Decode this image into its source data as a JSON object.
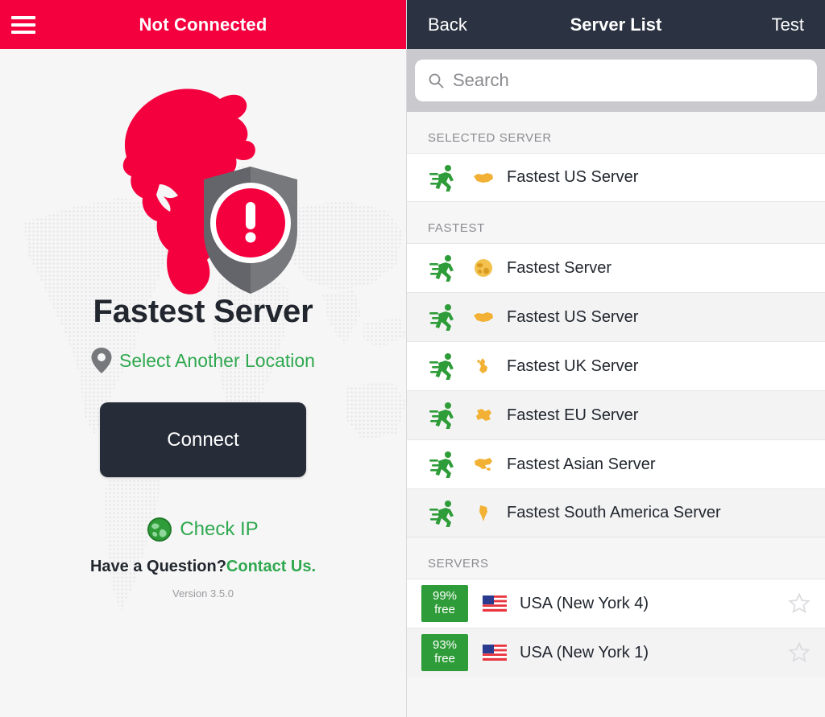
{
  "left": {
    "header": {
      "menu_icon": "hamburger-icon",
      "status_title": "Not Connected"
    },
    "logo": {
      "icon": "detective-shield-alert-logo"
    },
    "brand_title": "Fastest Server",
    "select_location": {
      "icon": "map-pin-icon",
      "label": "Select Another Location"
    },
    "connect_button": "Connect",
    "check_ip": {
      "icon": "globe-icon",
      "label": "Check IP"
    },
    "footer": {
      "question_text": "Have a Question?",
      "contact_link": "Contact Us.",
      "version": "Version 3.5.0"
    }
  },
  "right": {
    "header": {
      "back": "Back",
      "title": "Server List",
      "test": "Test"
    },
    "search": {
      "icon": "search-icon",
      "value": "",
      "placeholder": "Search"
    },
    "sections": [
      {
        "id": "selected-server",
        "title": "SELECTED SERVER",
        "rows": [
          {
            "icon": "runner-icon",
            "region_icon": "usa-map-icon",
            "label": "Fastest US Server"
          }
        ]
      },
      {
        "id": "fastest",
        "title": "FASTEST",
        "rows": [
          {
            "icon": "runner-icon",
            "region_icon": "globe-icon",
            "label": "Fastest Server"
          },
          {
            "icon": "runner-icon",
            "region_icon": "usa-map-icon",
            "label": "Fastest US Server"
          },
          {
            "icon": "runner-icon",
            "region_icon": "uk-map-icon",
            "label": "Fastest UK Server"
          },
          {
            "icon": "runner-icon",
            "region_icon": "eu-map-icon",
            "label": "Fastest EU Server"
          },
          {
            "icon": "runner-icon",
            "region_icon": "asia-map-icon",
            "label": "Fastest Asian Server"
          },
          {
            "icon": "runner-icon",
            "region_icon": "south-america-map-icon",
            "label": "Fastest South America Server"
          }
        ]
      },
      {
        "id": "servers",
        "title": "SERVERS",
        "rows": [
          {
            "badge_pct": "99%",
            "badge_unit": "free",
            "flag": "us-flag-icon",
            "label": "USA (New York 4)",
            "star": "star-outline-icon"
          },
          {
            "badge_pct": "93%",
            "badge_unit": "free",
            "flag": "us-flag-icon",
            "label": "USA (New York 1)",
            "star": "star-outline-icon"
          }
        ]
      }
    ]
  },
  "colors": {
    "brand_red": "#f4003f",
    "header_navy": "#2b3241",
    "accent_green": "#2fa84f",
    "badge_green": "#2e9c38",
    "region_orange": "#f2b134",
    "panel_bg": "#f6f6f6"
  }
}
